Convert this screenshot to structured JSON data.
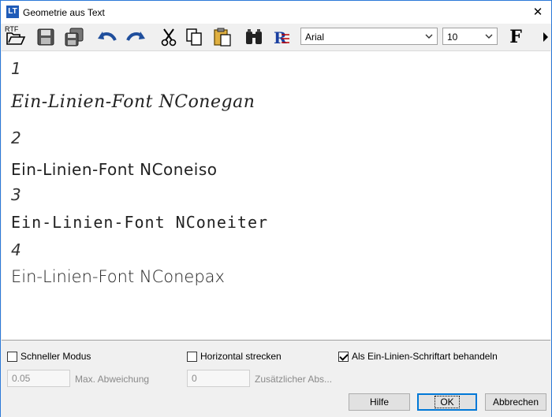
{
  "window": {
    "title": "Geometrie aus Text",
    "app_icon": "LT"
  },
  "toolbar": {
    "rtf_label": "RTF",
    "font": {
      "selected": "Arial"
    },
    "size": {
      "selected": "10"
    },
    "bold_label": "F"
  },
  "editor": {
    "lines": [
      {
        "number": "1",
        "text": "Ein-Linien-Font NConegan"
      },
      {
        "number": "2",
        "text": "Ein-Linien-Font NConeiso"
      },
      {
        "number": "3",
        "text": "Ein-Linien-Font NConeiter"
      },
      {
        "number": "4",
        "text": "Ein-Linien-Font NConepax"
      }
    ]
  },
  "options": {
    "fast_mode": {
      "label": "Schneller Modus",
      "checked": false
    },
    "stretch_horizontal": {
      "label": "Horizontal strecken",
      "checked": false
    },
    "single_line_font": {
      "label": "Als Ein-Linien-Schriftart behandeln",
      "checked": true
    },
    "max_deviation": {
      "value": "0.05",
      "label": "Max. Abweichung"
    },
    "extra_spacing": {
      "value": "0",
      "label": "Zusätzlicher Abs..."
    }
  },
  "buttons": {
    "help": "Hilfe",
    "ok": "OK",
    "cancel": "Abbrechen"
  },
  "colors": {
    "accent": "#0078d7",
    "title_border": "#2b79d8",
    "arrow_blue": "#1f4e9c"
  }
}
